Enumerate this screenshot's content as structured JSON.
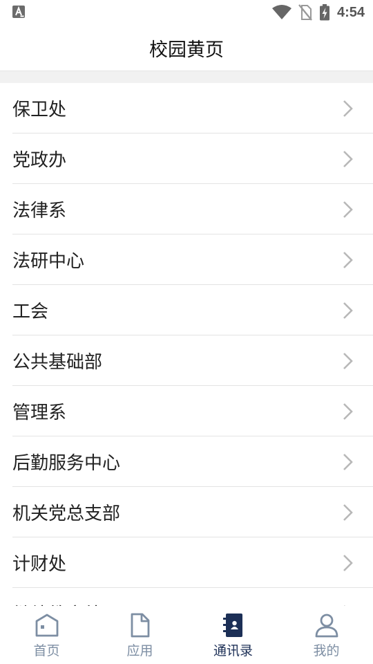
{
  "status_bar": {
    "time": "4:54",
    "icons": [
      "font-a-notification-icon",
      "wifi-icon",
      "no-sim-icon",
      "battery-charging-icon"
    ]
  },
  "header": {
    "title": "校园黄页"
  },
  "list": {
    "items": [
      {
        "label": "保卫处"
      },
      {
        "label": "党政办"
      },
      {
        "label": "法律系"
      },
      {
        "label": "法研中心"
      },
      {
        "label": "工会"
      },
      {
        "label": "公共基础部"
      },
      {
        "label": "管理系"
      },
      {
        "label": "后勤服务中心"
      },
      {
        "label": "机关党总支部"
      },
      {
        "label": "计财处"
      },
      {
        "label": "继续教育处"
      }
    ]
  },
  "tabs": [
    {
      "label": "首页",
      "icon": "home-icon",
      "active": false
    },
    {
      "label": "应用",
      "icon": "document-icon",
      "active": false
    },
    {
      "label": "通讯录",
      "icon": "contacts-book-icon",
      "active": true
    },
    {
      "label": "我的",
      "icon": "user-icon",
      "active": false
    }
  ],
  "colors": {
    "tab_active": "#1c2f56",
    "tab_inactive": "#7d8ea3",
    "divider": "#e3e3e3",
    "chevron": "#b8b8b8"
  }
}
